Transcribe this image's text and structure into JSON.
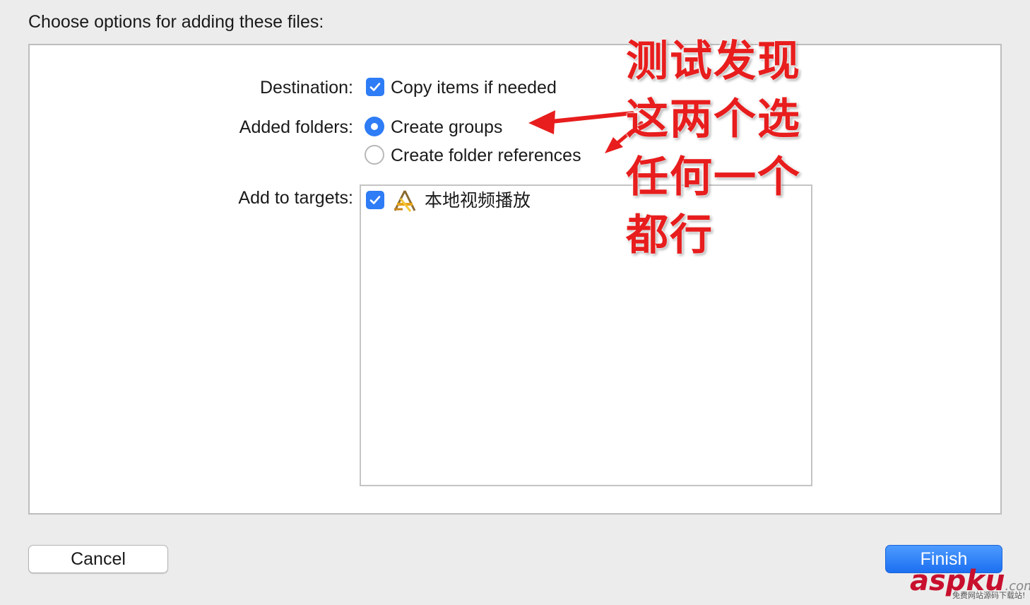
{
  "dialog": {
    "prompt": "Choose options for adding these files:"
  },
  "options": {
    "destination_label": "Destination:",
    "copy_items_label": "Copy items if needed",
    "copy_items_checked": true,
    "added_folders_label": "Added folders:",
    "radio_options": [
      {
        "label": "Create groups",
        "selected": true
      },
      {
        "label": "Create folder references",
        "selected": false
      }
    ],
    "add_to_targets_label": "Add to targets:",
    "targets": [
      {
        "name": "本地视频播放",
        "checked": true,
        "icon": "app-target-icon"
      }
    ]
  },
  "annotation": {
    "lines": [
      "测试发现",
      "这两个选",
      "任何一个",
      "都行"
    ],
    "color": "#e81d1d"
  },
  "buttons": {
    "cancel": "Cancel",
    "finish": "Finish"
  },
  "watermark": {
    "brand": "aspku",
    "tld": ".com",
    "tagline": "免费网站源码下载站!"
  },
  "colors": {
    "accent": "#2e7cf6",
    "annotation": "#e81d1d"
  }
}
